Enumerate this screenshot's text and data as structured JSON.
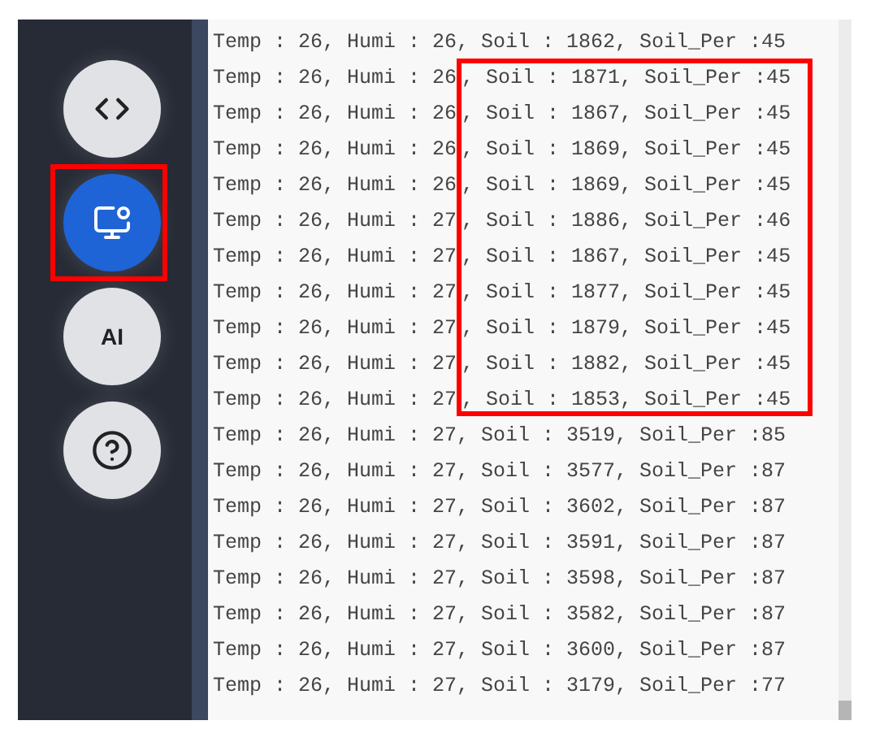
{
  "sidebar": {
    "buttons": [
      {
        "kind": "code",
        "selected": false,
        "highlighted": false
      },
      {
        "kind": "monitor",
        "selected": true,
        "highlighted": true
      },
      {
        "kind": "text",
        "label": "AI",
        "selected": false,
        "highlighted": false
      },
      {
        "kind": "help",
        "selected": false,
        "highlighted": false
      }
    ]
  },
  "log": {
    "lines": [
      {
        "text": "Temp : 26, Humi : 26, Soil : 1862, Soil_Per :45"
      },
      {
        "text": "Temp : 26, Humi : 26",
        "framed_text": ", Soil : 1871, Soil_Per :45"
      },
      {
        "text": "Temp : 26, Humi : 26",
        "framed_text": ", Soil : 1867, Soil_Per :45"
      },
      {
        "text": "Temp : 26, Humi : 26",
        "framed_text": ", Soil : 1869, Soil_Per :45"
      },
      {
        "text": "Temp : 26, Humi : 26",
        "framed_text": ", Soil : 1869, Soil_Per :45"
      },
      {
        "text": "Temp : 26, Humi : 27",
        "framed_text": ", Soil : 1886, Soil_Per :46"
      },
      {
        "text": "Temp : 26, Humi : 27",
        "framed_text": ", Soil : 1867, Soil_Per :45"
      },
      {
        "text": "Temp : 26, Humi : 27",
        "framed_text": ", Soil : 1877, Soil_Per :45"
      },
      {
        "text": "Temp : 26, Humi : 27",
        "framed_text": ", Soil : 1879, Soil_Per :45"
      },
      {
        "text": "Temp : 26, Humi : 27",
        "framed_text": ", Soil : 1882, Soil_Per :45"
      },
      {
        "text": "Temp : 26, Humi : 27",
        "framed_text": ", Soil : 1853, Soil_Per :45"
      },
      {
        "text": "Temp : 26, Humi : 27, Soil : 3519, Soil_Per :85"
      },
      {
        "text": "Temp : 26, Humi : 27, Soil : 3577, Soil_Per :87"
      },
      {
        "text": "Temp : 26, Humi : 27, Soil : 3602, Soil_Per :87"
      },
      {
        "text": "Temp : 26, Humi : 27, Soil : 3591, Soil_Per :87"
      },
      {
        "text": "Temp : 26, Humi : 27, Soil : 3598, Soil_Per :87"
      },
      {
        "text": "Temp : 26, Humi : 27, Soil : 3582, Soil_Per :87"
      },
      {
        "text": "Temp : 26, Humi : 27, Soil : 3600, Soil_Per :87"
      },
      {
        "text": "Temp : 26, Humi : 27, Soil : 3179, Soil_Per :77"
      }
    ]
  }
}
